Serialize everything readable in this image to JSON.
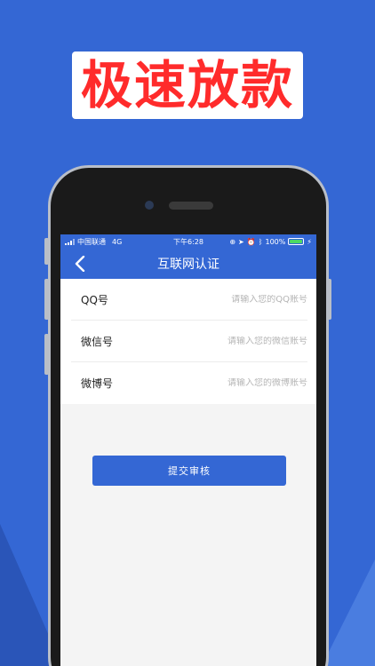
{
  "promo": {
    "headline": "极速放款"
  },
  "status_bar": {
    "carrier": "中国联通",
    "network": "4G",
    "time": "下午6:28",
    "battery": "100%"
  },
  "nav": {
    "title": "互联网认证"
  },
  "form": {
    "fields": [
      {
        "label": "QQ号",
        "placeholder": "请输入您的QQ账号"
      },
      {
        "label": "微信号",
        "placeholder": "请输入您的微信账号"
      },
      {
        "label": "微博号",
        "placeholder": "请输入您的微博账号"
      }
    ]
  },
  "submit": {
    "label": "提交审核"
  },
  "colors": {
    "background": "#3467d4",
    "headline": "#ff2b2b",
    "accent": "#3467d4"
  },
  "icons": [
    "back-chevron-icon",
    "signal-icon",
    "location-icon",
    "alarm-icon",
    "bluetooth-icon",
    "battery-icon",
    "charging-icon"
  ]
}
